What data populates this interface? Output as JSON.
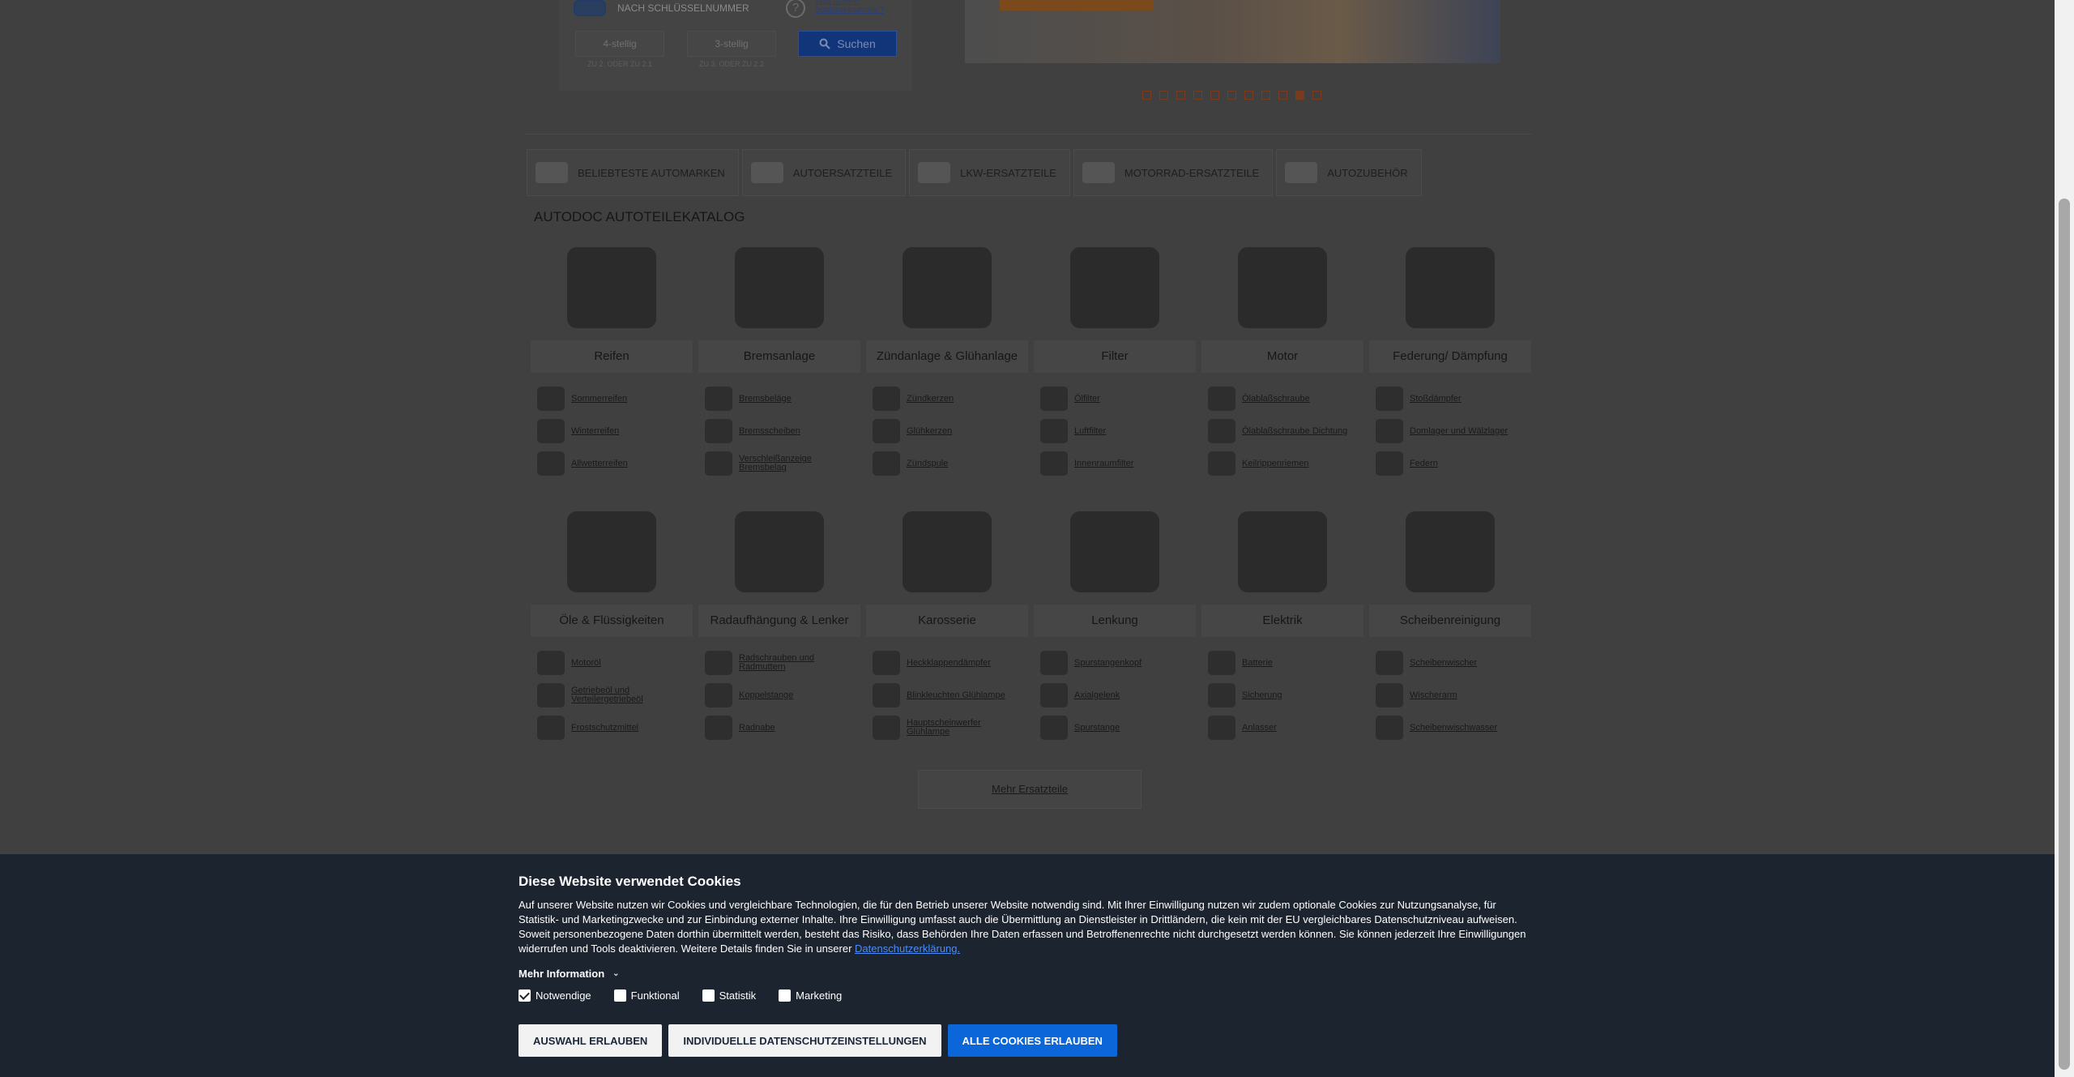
{
  "key_search": {
    "label": "NACH SCHLÜSSELNUMMER",
    "help_link": "Was ist eine Schlüsselnummer?",
    "input1_placeholder": "4-stellig",
    "input1_hint": "ZU 2. ODER ZU 2.1",
    "input2_placeholder": "3-stellig",
    "input2_hint": "ZU 3. ODER ZU 2.2",
    "search_button": "Suchen",
    "help_symbol": "?"
  },
  "slider": {
    "dots": 11,
    "active_index": 9
  },
  "tabs": [
    {
      "label": "BELIEBTESTE AUTOMARKEN",
      "icon": "car-icon"
    },
    {
      "label": "AUTOERSATZTEILE",
      "icon": "parts-icon"
    },
    {
      "label": "LKW-ERSATZTEILE",
      "icon": "truck-icon"
    },
    {
      "label": "MOTORRAD-ERSATZTEILE",
      "icon": "motorcycle-icon"
    },
    {
      "label": "AUTOZUBEHÖR",
      "icon": "accessories-icon"
    }
  ],
  "catalog": {
    "title": "AUTODOC AUTOTEILEKATALOG",
    "categories": [
      {
        "name": "Reifen",
        "subs": [
          "Sommerreifen",
          "Winterreifen",
          "Allwetterreifen"
        ]
      },
      {
        "name": "Bremsanlage",
        "subs": [
          "Bremsbeläge",
          "Bremsscheiben",
          "Verschleißanzeige Bremsbelag"
        ]
      },
      {
        "name": "Zündanlage & Glühanlage",
        "subs": [
          "Zündkerzen",
          "Glühkerzen",
          "Zündspule"
        ]
      },
      {
        "name": "Filter",
        "subs": [
          "Ölfilter",
          "Luftfilter",
          "Innenraumfilter"
        ]
      },
      {
        "name": "Motor",
        "subs": [
          "Ölablaßschraube",
          "Ölablaßschraube Dichtung",
          "Keilrippenriemen"
        ]
      },
      {
        "name": "Federung/ Dämpfung",
        "subs": [
          "Stoßdämpfer",
          "Domlager und Wälzlager",
          "Federn"
        ]
      },
      {
        "name": "Öle & Flüssigkeiten",
        "subs": [
          "Motoröl",
          "Getriebeöl und Verteilergetriebeöl",
          "Frostschutzmittel"
        ]
      },
      {
        "name": "Radaufhängung & Lenker",
        "subs": [
          "Radschrauben und Radmuttern",
          "Koppelstange",
          "Radnabe"
        ]
      },
      {
        "name": "Karosserie",
        "subs": [
          "Heckklappendämpfer",
          "Blinkleuchten Glühlampe",
          "Hauptscheinwerfer Glühlampe"
        ]
      },
      {
        "name": "Lenkung",
        "subs": [
          "Spurstangenkopf",
          "Axialgelenk",
          "Spurstange"
        ]
      },
      {
        "name": "Elektrik",
        "subs": [
          "Batterie",
          "Sicherung",
          "Anlasser"
        ]
      },
      {
        "name": "Scheibenreinigung",
        "subs": [
          "Scheibenwischer",
          "Wischerarm",
          "Scheibenwischwasser"
        ]
      }
    ],
    "more_button": "Mehr Ersatzteile"
  },
  "cookie": {
    "title": "Diese Website verwendet Cookies",
    "text": "Auf unserer Website nutzen wir Cookies und vergleichbare Technologien, die für den Betrieb unserer Website notwendig sind. Mit Ihrer Einwilligung nutzen wir zudem optionale Cookies zur Nutzungsanalyse, für Statistik- und Marketingzwecke und zur Einbindung externer Inhalte. Ihre Einwilligung umfasst auch die Übermittlung an Dienstleister in Drittländern, die kein mit der EU vergleichbares Datenschutzniveau aufweisen. Soweit personenbezogene Daten dorthin übermittelt werden, besteht das Risiko, dass Behörden Ihre Daten erfassen und Betroffenenrechte nicht durchgesetzt werden können. Sie können jederzeit Ihre Einwilligungen widerrufen und Tools deaktivieren. Weitere Details finden Sie in unserer",
    "link": "Datenschutzerklärung.",
    "more_info": "Mehr Information",
    "checks": [
      {
        "label": "Notwendige",
        "checked": true
      },
      {
        "label": "Funktional",
        "checked": false
      },
      {
        "label": "Statistik",
        "checked": false
      },
      {
        "label": "Marketing",
        "checked": false
      }
    ],
    "btn_selection": "AUSWAHL ERLAUBEN",
    "btn_individual": "INDIVIDUELLE DATENSCHUTZEINSTELLUNGEN",
    "btn_all": "ALLE COOKIES ERLAUBEN"
  },
  "colors": {
    "cookie_bg": "#1c2430",
    "primary": "#0a66d9",
    "link": "#4d8df6",
    "accent": "#7a3a1e"
  }
}
